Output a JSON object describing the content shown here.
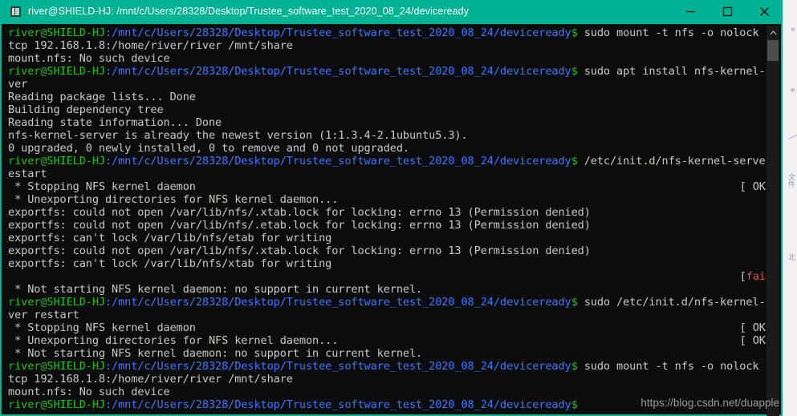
{
  "window": {
    "title": "river@SHIELD-HJ: /mnt/c/Users/28328/Desktop/Trustee_software_test_2020_08_24/deviceready",
    "icon": "terminal-window-icon",
    "accent_color": "#00b294",
    "background_color": "#0c0c0c",
    "minimize_label": "—",
    "maximize_label": "□",
    "close_label": "✕"
  },
  "scrollbar": {
    "up_arrow": "∧",
    "thumb_color": "#4d4d4d"
  },
  "watermark": {
    "text": "https://blog.csdn.net/duapple"
  },
  "terminal": {
    "prompt_user": "river@SHIELD-HJ",
    "prompt_path": ":/mnt/c/Users/28328/Desktop/Trustee_software_test_2020_08_24/deviceready",
    "prompt_symbol": "$",
    "colors": {
      "user": "#16c60c",
      "path": "#3b78ff",
      "text": "#ccc9c2",
      "error": "#e74856"
    },
    "lines": [
      {
        "type": "prompt",
        "command": " sudo mount -t nfs -o nolock -o"
      },
      {
        "type": "out",
        "text": "tcp 192.168.1.8:/home/river/river /mnt/share"
      },
      {
        "type": "out",
        "text": "mount.nfs: No such device"
      },
      {
        "type": "prompt",
        "command": " sudo apt install nfs-kernel-ser"
      },
      {
        "type": "out",
        "text": "ver"
      },
      {
        "type": "out",
        "text": "Reading package lists... Done"
      },
      {
        "type": "out",
        "text": "Building dependency tree"
      },
      {
        "type": "out",
        "text": "Reading state information... Done"
      },
      {
        "type": "out",
        "text": "nfs-kernel-server is already the newest version (1:1.3.4-2.1ubuntu5.3)."
      },
      {
        "type": "out",
        "text": "0 upgraded, 0 newly installed, 0 to remove and 0 not upgraded."
      },
      {
        "type": "prompt",
        "command": " /etc/init.d/nfs-kernel-server r"
      },
      {
        "type": "out",
        "text": "estart"
      },
      {
        "type": "out",
        "text": " * Stopping NFS kernel daemon",
        "tag": "[ OK ]",
        "tag_state": "ok"
      },
      {
        "type": "out",
        "text": " * Unexporting directories for NFS kernel daemon..."
      },
      {
        "type": "out",
        "text": "exportfs: could not open /var/lib/nfs/.xtab.lock for locking: errno 13 (Permission denied)"
      },
      {
        "type": "out",
        "text": "exportfs: could not open /var/lib/nfs/.etab.lock for locking: errno 13 (Permission denied)"
      },
      {
        "type": "out",
        "text": "exportfs: can't lock /var/lib/nfs/etab for writing"
      },
      {
        "type": "out",
        "text": "exportfs: could not open /var/lib/nfs/.xtab.lock for locking: errno 13 (Permission denied)"
      },
      {
        "type": "out",
        "text": "exportfs: can't lock /var/lib/nfs/xtab for writing"
      },
      {
        "type": "out",
        "text": "",
        "tag": "[fail]",
        "tag_state": "fail"
      },
      {
        "type": "out",
        "text": " * Not starting NFS kernel daemon: no support in current kernel."
      },
      {
        "type": "prompt",
        "command": " sudo /etc/init.d/nfs-kernel-ser"
      },
      {
        "type": "out",
        "text": "ver restart"
      },
      {
        "type": "out",
        "text": " * Stopping NFS kernel daemon",
        "tag": "[ OK ]",
        "tag_state": "ok"
      },
      {
        "type": "out",
        "text": " * Unexporting directories for NFS kernel daemon...",
        "tag": "[ OK ]",
        "tag_state": "ok"
      },
      {
        "type": "out",
        "text": " * Not starting NFS kernel daemon: no support in current kernel."
      },
      {
        "type": "prompt",
        "command": " sudo mount -t nfs -o nolock -o"
      },
      {
        "type": "out",
        "text": "tcp 192.168.1.8:/home/river/river /mnt/share"
      },
      {
        "type": "out",
        "text": "mount.nfs: No such device"
      },
      {
        "type": "prompt",
        "command": ""
      }
    ]
  },
  "background_strips": [
    {
      "text": "≡"
    },
    {
      "text": "e."
    },
    {
      "text": "╲"
    },
    {
      "text": "文件"
    },
    {
      "text": "北"
    }
  ]
}
